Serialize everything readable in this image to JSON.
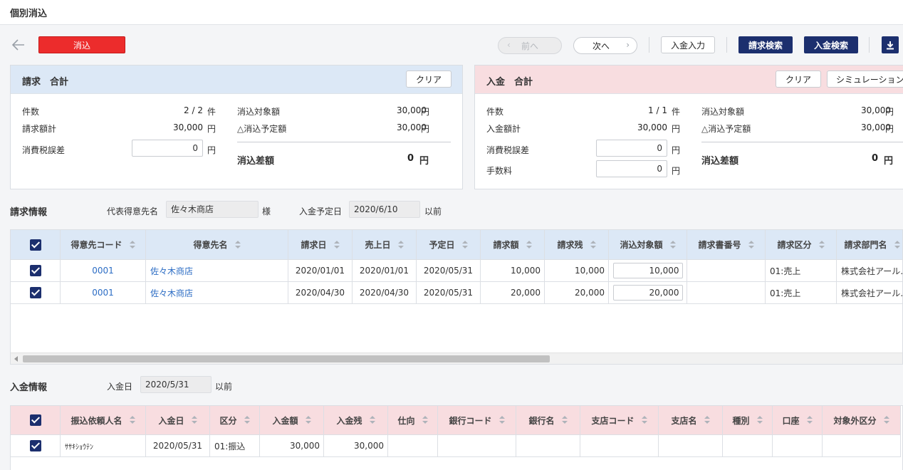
{
  "header": {
    "title": "個別消込"
  },
  "toolbar": {
    "keshikomi": "消込",
    "prev": "前へ",
    "next": "次へ",
    "nyukin_input": "入金入力",
    "seikyu_search": "請求検索",
    "nyukin_search": "入金検索"
  },
  "seikyu_total": {
    "title": "請求　合計",
    "clear": "クリア",
    "count_label": "件数",
    "count_value": "2 / 2",
    "count_unit": "件",
    "amount_label": "請求額計",
    "amount_value": "30,000",
    "yen": "円",
    "tax_label": "消費税誤差",
    "tax_value": "0",
    "target_label": "消込対象額",
    "target_value": "30,000",
    "planned_label": "△消込予定額",
    "planned_value": "30,000",
    "diff_label": "消込差額",
    "diff_value": "0"
  },
  "nyukin_total": {
    "title": "入金　合計",
    "clear": "クリア",
    "simulation": "シミュレーション",
    "count_label": "件数",
    "count_value": "1 / 1",
    "count_unit": "件",
    "amount_label": "入金額計",
    "amount_value": "30,000",
    "yen": "円",
    "tax_label": "消費税誤差",
    "tax_value": "0",
    "fee_label": "手数料",
    "fee_value": "0",
    "target_label": "消込対象額",
    "target_value": "30,000",
    "planned_label": "△消込予定額",
    "planned_value": "30,000",
    "diff_label": "消込差額",
    "diff_value": "0"
  },
  "seikyu_info": {
    "title": "請求情報",
    "rep_label": "代表得意先名",
    "rep_value": "佐々木商店",
    "sama": "様",
    "date_label": "入金予定日",
    "date_value": "2020/6/10",
    "before": "以前",
    "columns": [
      "得意先コード",
      "得意先名",
      "請求日",
      "売上日",
      "予定日",
      "請求額",
      "請求残",
      "消込対象額",
      "請求書番号",
      "請求区分",
      "請求部門名"
    ],
    "rows": [
      [
        "0001",
        "佐々木商店",
        "2020/01/01",
        "2020/01/01",
        "2020/05/31",
        "10,000",
        "10,000",
        "10,000",
        "",
        "01:売上",
        "株式会社アール…"
      ],
      [
        "0001",
        "佐々木商店",
        "2020/04/30",
        "2020/04/30",
        "2020/05/31",
        "20,000",
        "20,000",
        "20,000",
        "",
        "01:売上",
        "株式会社アール…"
      ]
    ]
  },
  "nyukin_info": {
    "title": "入金情報",
    "date_label": "入金日",
    "date_value": "2020/5/31",
    "before": "以前",
    "columns": [
      "振込依頼人名",
      "入金日",
      "区分",
      "入金額",
      "入金残",
      "仕向",
      "銀行コード",
      "銀行名",
      "支店コード",
      "支店名",
      "種別",
      "口座",
      "対象外区分"
    ],
    "rows": [
      [
        "ｻｻｷｼｮｳﾃﾝ",
        "2020/05/31",
        "01:振込",
        "30,000",
        "30,000",
        "",
        "",
        "",
        "",
        "",
        "",
        "",
        ""
      ]
    ]
  },
  "colors": {
    "red": "#ec2c2c",
    "navy": "#1c2f6e",
    "blue_header": "#dce8f6",
    "pink_header": "#f8dde0",
    "link": "#2b6cc4"
  },
  "icons": [
    "back-arrow-icon",
    "chevron-left-icon",
    "chevron-right-icon",
    "download-icon",
    "checkbox-checked-icon",
    "sort-icon"
  ]
}
